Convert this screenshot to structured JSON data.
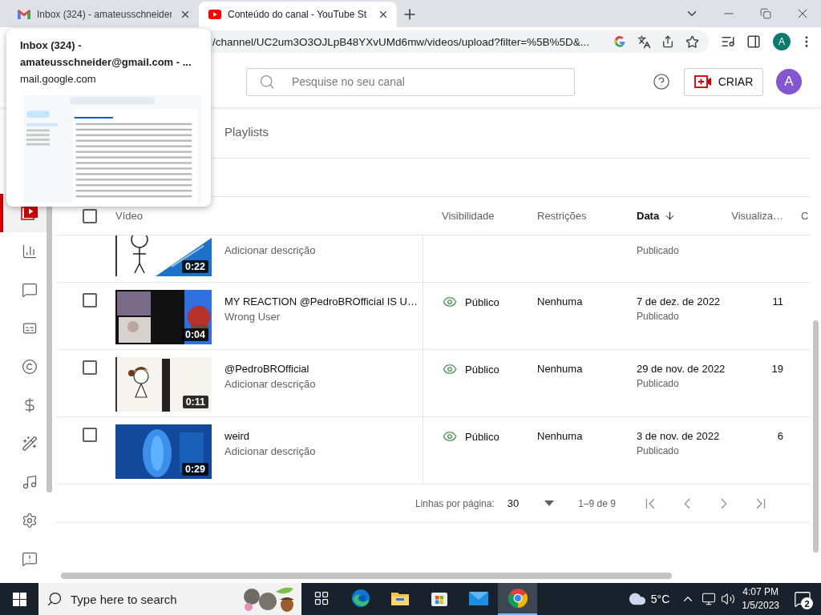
{
  "browser": {
    "tabs": [
      {
        "kind": "mail",
        "title": "Inbox (324) - amateusschneider",
        "selected": false
      },
      {
        "kind": "video",
        "title": "Conteúdo do canal - YouTube St",
        "selected": true
      }
    ],
    "url": "/channel/UC2um3O3OJLpB48YXvUMd6mw/videos/upload?filter=%5B%5D&...",
    "profile": "A"
  },
  "tab_tooltip": {
    "title": "Inbox (324) - amateusschneider@gmail.com - ...",
    "domain": "mail.google.com"
  },
  "header": {
    "search_placeholder": "Pesquise no seu canal",
    "create_label": "CRIAR",
    "avatar": "A"
  },
  "sidebar": {
    "items": [
      {
        "kind": "content",
        "selected": true
      },
      {
        "kind": "analytics",
        "selected": false
      },
      {
        "kind": "comments",
        "selected": false
      },
      {
        "kind": "subtitles",
        "selected": false
      },
      {
        "kind": "copyright",
        "selected": false
      },
      {
        "kind": "earn",
        "selected": false
      },
      {
        "kind": "customization",
        "selected": false
      },
      {
        "kind": "audio",
        "selected": false
      },
      {
        "kind": "settings",
        "selected": false
      },
      {
        "kind": "feedback",
        "selected": false
      }
    ]
  },
  "content_tabs": [
    {
      "label": "Playlists",
      "selected": false
    }
  ],
  "table": {
    "select_all": {
      "checked": false
    },
    "columns": [
      {
        "label": "Vídeo",
        "sorted": false
      },
      {
        "label": "Visibilidade",
        "sorted": false
      },
      {
        "label": "Restrições",
        "sorted": false
      },
      {
        "label": "Data",
        "sorted": true
      },
      {
        "label": "Visualiza…",
        "sorted": false
      },
      {
        "label": "C",
        "sorted": false
      }
    ],
    "rows": [
      {
        "kind": "partial",
        "description": "Adicionar descrição",
        "duration": "0:22",
        "status": "Publicado"
      },
      {
        "kind": "full",
        "title": "MY REACTION @PedroBROfficial IS U…",
        "description": "Wrong User",
        "duration": "0:04",
        "visibility": "Público",
        "restrictions": "Nenhuma",
        "date": "7 de dez. de 2022",
        "status": "Publicado",
        "views": "11",
        "checked": false
      },
      {
        "kind": "full",
        "title": "@PedroBROfficial",
        "description": "Adicionar descrição",
        "duration": "0:11",
        "visibility": "Público",
        "restrictions": "Nenhuma",
        "date": "29 de nov. de 2022",
        "status": "Publicado",
        "views": "19",
        "checked": false
      },
      {
        "kind": "full",
        "title": "weird",
        "description": "Adicionar descrição",
        "duration": "0:29",
        "visibility": "Público",
        "restrictions": "Nenhuma",
        "date": "3 de nov. de 2022",
        "status": "Publicado",
        "views": "6",
        "checked": false
      }
    ]
  },
  "pagination": {
    "rows_label": "Linhas por página:",
    "rows_value": "30",
    "range": "1–9 de 9"
  },
  "taskbar": {
    "search_placeholder": "Type here to search",
    "apps": [
      {
        "kind": "task-view",
        "active": false
      },
      {
        "kind": "edge",
        "active": false
      },
      {
        "kind": "explorer",
        "active": false
      },
      {
        "kind": "store",
        "active": false
      },
      {
        "kind": "mail",
        "active": false
      },
      {
        "kind": "chrome",
        "active": true
      }
    ],
    "weather": "5°C",
    "time": "4:07 PM",
    "date": "1/5/2023",
    "notifications": "2"
  }
}
